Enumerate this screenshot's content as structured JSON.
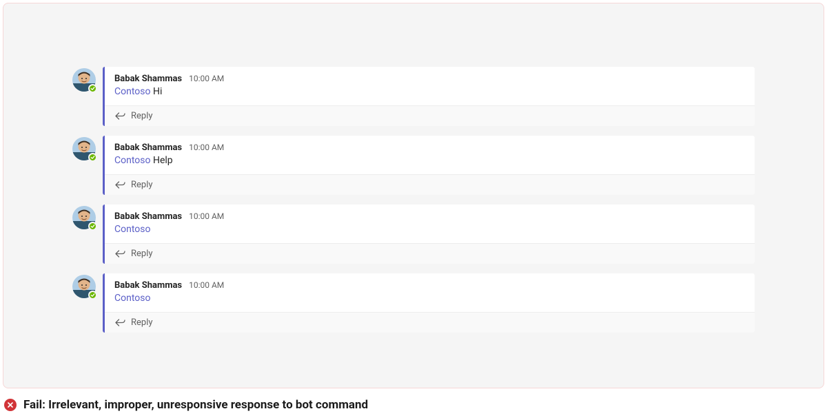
{
  "reply_label": "Reply",
  "messages": [
    {
      "author": "Babak Shammas",
      "time": "10:00 AM",
      "mention": "Contoso",
      "text": "Hi"
    },
    {
      "author": "Babak Shammas",
      "time": "10:00 AM",
      "mention": "Contoso",
      "text": "Help"
    },
    {
      "author": "Babak Shammas",
      "time": "10:00 AM",
      "mention": "Contoso",
      "text": ""
    },
    {
      "author": "Babak Shammas",
      "time": "10:00 AM",
      "mention": "Contoso",
      "text": ""
    }
  ],
  "footer": {
    "label": "Fail: Irrelevant, improper, unresponsive response to bot command"
  }
}
